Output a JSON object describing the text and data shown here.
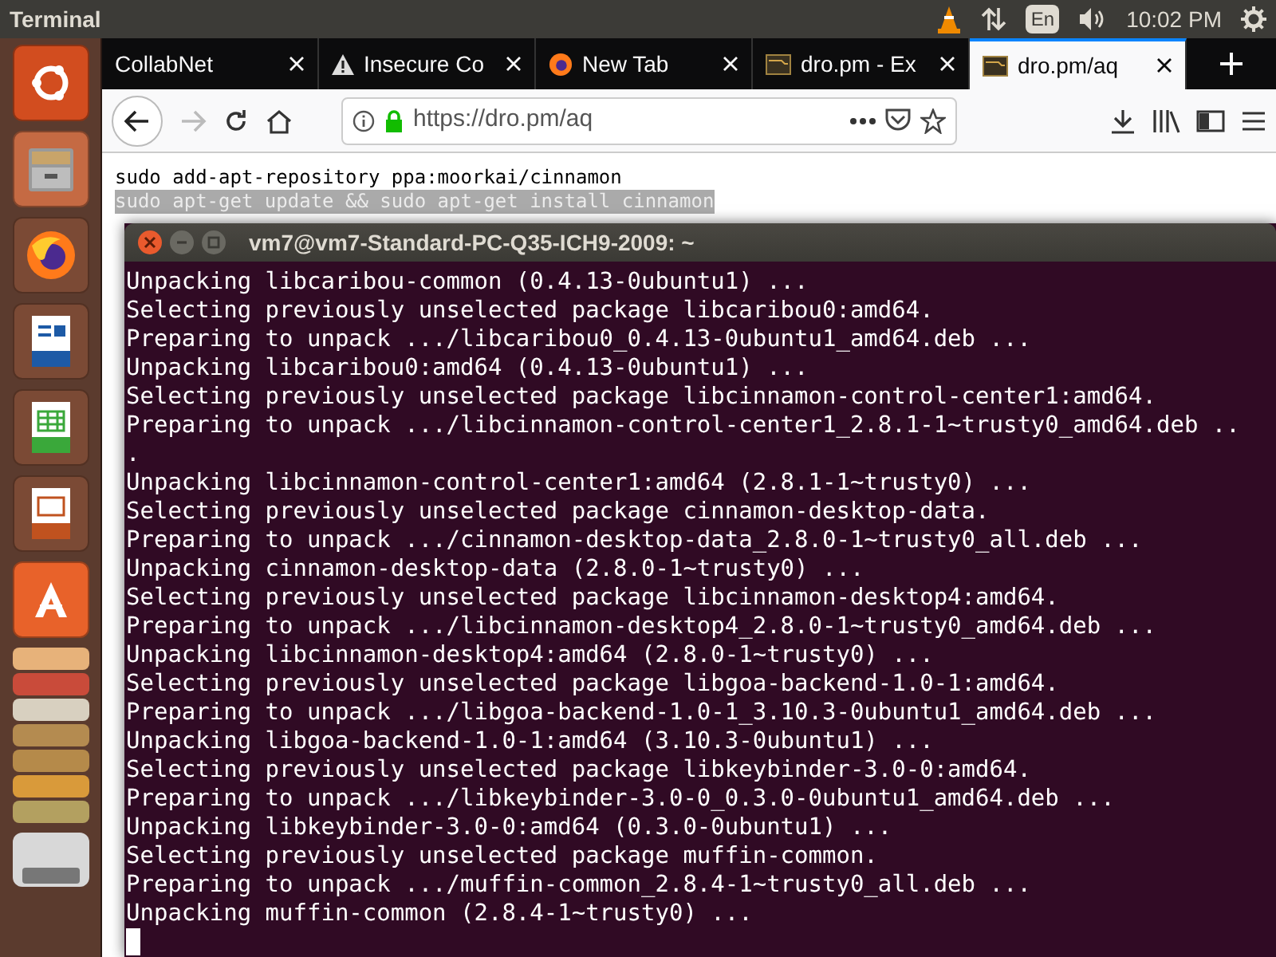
{
  "top_bar": {
    "title": "Terminal",
    "keyboard": "En",
    "clock": "10:02 PM"
  },
  "browser": {
    "tabs": [
      {
        "label": "CollabNet",
        "kind": "plain",
        "selected": false
      },
      {
        "label": "Insecure Co",
        "kind": "warning",
        "selected": false
      },
      {
        "label": "New Tab",
        "kind": "browser",
        "selected": false
      },
      {
        "label": "dro.pm - Ex",
        "kind": "site",
        "selected": false
      },
      {
        "label": "dro.pm/aq",
        "kind": "site",
        "selected": true
      }
    ],
    "url": "https://dro.pm/aq",
    "page_lines": [
      {
        "text": "sudo add-apt-repository ppa:moorkai/cinnamon",
        "selected": false
      },
      {
        "text": "sudo apt-get update && sudo apt-get install cinnamon",
        "selected": true
      }
    ]
  },
  "terminal": {
    "title": "vm7@vm7-Standard-PC-Q35-ICH9-2009: ~",
    "cursor": true,
    "lines": [
      "Unpacking libcaribou-common (0.4.13-0ubuntu1) ...",
      "Selecting previously unselected package libcaribou0:amd64.",
      "Preparing to unpack .../libcaribou0_0.4.13-0ubuntu1_amd64.deb ...",
      "Unpacking libcaribou0:amd64 (0.4.13-0ubuntu1) ...",
      "Selecting previously unselected package libcinnamon-control-center1:amd64.",
      "Preparing to unpack .../libcinnamon-control-center1_2.8.1-1~trusty0_amd64.deb ..",
      ".",
      "Unpacking libcinnamon-control-center1:amd64 (2.8.1-1~trusty0) ...",
      "Selecting previously unselected package cinnamon-desktop-data.",
      "Preparing to unpack .../cinnamon-desktop-data_2.8.0-1~trusty0_all.deb ...",
      "Unpacking cinnamon-desktop-data (2.8.0-1~trusty0) ...",
      "Selecting previously unselected package libcinnamon-desktop4:amd64.",
      "Preparing to unpack .../libcinnamon-desktop4_2.8.0-1~trusty0_amd64.deb ...",
      "Unpacking libcinnamon-desktop4:amd64 (2.8.0-1~trusty0) ...",
      "Selecting previously unselected package libgoa-backend-1.0-1:amd64.",
      "Preparing to unpack .../libgoa-backend-1.0-1_3.10.3-0ubuntu1_amd64.deb ...",
      "Unpacking libgoa-backend-1.0-1:amd64 (3.10.3-0ubuntu1) ...",
      "Selecting previously unselected package libkeybinder-3.0-0:amd64.",
      "Preparing to unpack .../libkeybinder-3.0-0_0.3.0-0ubuntu1_amd64.deb ...",
      "Unpacking libkeybinder-3.0-0:amd64 (0.3.0-0ubuntu1) ...",
      "Selecting previously unselected package muffin-common.",
      "Preparing to unpack .../muffin-common_2.8.4-1~trusty0_all.deb ...",
      "Unpacking muffin-common (2.8.4-1~trusty0) ..."
    ]
  }
}
